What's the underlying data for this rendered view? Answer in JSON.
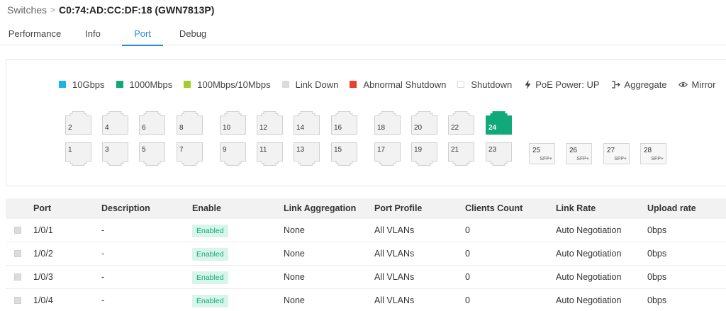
{
  "breadcrumb": {
    "parent": "Switches",
    "separator": ">",
    "current": "C0:74:AD:CC:DF:18 (GWN7813P)"
  },
  "tabs": [
    {
      "label": "Performance",
      "active": false
    },
    {
      "label": "Info",
      "active": false
    },
    {
      "label": "Port",
      "active": true
    },
    {
      "label": "Debug",
      "active": false
    }
  ],
  "legend": [
    {
      "label": "10Gbps",
      "color": "#1ab5e6",
      "icon": "square"
    },
    {
      "label": "1000Mbps",
      "color": "#11a87a",
      "icon": "square"
    },
    {
      "label": "100Mbps/10Mbps",
      "color": "#a6cc28",
      "icon": "square"
    },
    {
      "label": "Link Down",
      "color": "#dcdcdc",
      "icon": "square"
    },
    {
      "label": "Abnormal Shutdown",
      "color": "#e8412c",
      "icon": "square"
    },
    {
      "label": "Shutdown",
      "color": "#ffffff",
      "icon": "square-outline"
    },
    {
      "label": "PoE Power: UP",
      "icon": "lightning-icon"
    },
    {
      "label": "Aggregate",
      "icon": "aggregate-icon"
    },
    {
      "label": "Mirror",
      "icon": "eye-icon"
    }
  ],
  "colors": {
    "accent": "#2a8bd4",
    "link_down": "#f2f2f2",
    "port_up": "#11a87a",
    "enabled_bg": "#d7f5ea",
    "enabled_text": "#11a87a"
  },
  "ports": {
    "top": [
      {
        "num": "2",
        "status": "down"
      },
      {
        "num": "4",
        "status": "down"
      },
      {
        "num": "6",
        "status": "down"
      },
      {
        "num": "8",
        "status": "down"
      },
      {
        "num": "10",
        "status": "down"
      },
      {
        "num": "12",
        "status": "down"
      },
      {
        "num": "14",
        "status": "down"
      },
      {
        "num": "16",
        "status": "down"
      },
      {
        "num": "18",
        "status": "down"
      },
      {
        "num": "20",
        "status": "down"
      },
      {
        "num": "22",
        "status": "down"
      },
      {
        "num": "24",
        "status": "1000Mbps"
      }
    ],
    "bottom": [
      {
        "num": "1",
        "status": "down"
      },
      {
        "num": "3",
        "status": "down"
      },
      {
        "num": "5",
        "status": "down"
      },
      {
        "num": "7",
        "status": "down"
      },
      {
        "num": "9",
        "status": "down"
      },
      {
        "num": "11",
        "status": "down"
      },
      {
        "num": "13",
        "status": "down"
      },
      {
        "num": "15",
        "status": "down"
      },
      {
        "num": "17",
        "status": "down"
      },
      {
        "num": "19",
        "status": "down"
      },
      {
        "num": "21",
        "status": "down"
      },
      {
        "num": "23",
        "status": "down"
      }
    ],
    "sfp": [
      {
        "num": "25",
        "label": "SFP+"
      },
      {
        "num": "26",
        "label": "SFP+"
      },
      {
        "num": "27",
        "label": "SFP+"
      },
      {
        "num": "28",
        "label": "SFP+"
      }
    ]
  },
  "table": {
    "columns": [
      "Port",
      "Description",
      "Enable",
      "Link Aggregation",
      "Port Profile",
      "Clients Count",
      "Link Rate",
      "Upload rate"
    ],
    "rows": [
      {
        "port": "1/0/1",
        "description": "-",
        "enable": "Enabled",
        "aggregation": "None",
        "profile": "All VLANs",
        "clients": "0",
        "link_rate": "Auto Negotiation",
        "upload": "0bps"
      },
      {
        "port": "1/0/2",
        "description": "-",
        "enable": "Enabled",
        "aggregation": "None",
        "profile": "All VLANs",
        "clients": "0",
        "link_rate": "Auto Negotiation",
        "upload": "0bps"
      },
      {
        "port": "1/0/3",
        "description": "-",
        "enable": "Enabled",
        "aggregation": "None",
        "profile": "All VLANs",
        "clients": "0",
        "link_rate": "Auto Negotiation",
        "upload": "0bps"
      },
      {
        "port": "1/0/4",
        "description": "-",
        "enable": "Enabled",
        "aggregation": "None",
        "profile": "All VLANs",
        "clients": "0",
        "link_rate": "Auto Negotiation",
        "upload": "0bps"
      }
    ]
  }
}
